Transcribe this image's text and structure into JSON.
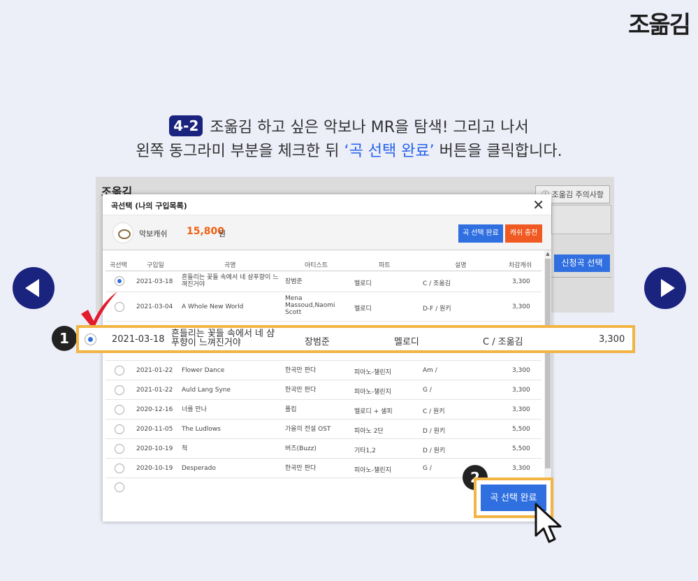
{
  "logo": "조옮김",
  "instruction": {
    "step": "4-2",
    "line1": "조옮김 하고 싶은 악보나 MR을 탐색! 그리고 나서",
    "line2_before": "왼쪽 동그라미 부분을 체크한 뒤 ",
    "line2_highlight": "‘곡 선택 완료’",
    "line2_after": " 버튼을 클릭합니다."
  },
  "background_page": {
    "title": "조옮김",
    "caution_button": "ⓘ 조옮김 주의사항",
    "apply_button": "신청곡 선택"
  },
  "modal": {
    "title": "곡선택 (나의 구입목록)",
    "close": "✕",
    "points_label": "악보캐쉬",
    "points_value": "15,800",
    "points_unit": "원",
    "complete_button": "곡 선택 완료",
    "charge_button": "캐쉬 충전",
    "columns": [
      "곡선택",
      "구입일",
      "곡명",
      "아티스트",
      "파트",
      "설명",
      "차감캐쉬"
    ],
    "rows": [
      {
        "selected": true,
        "date": "2021-03-18",
        "title": "흔들리는 꽃들 속에서 네 샴푸향이 느껴진거야",
        "artist": "장범준",
        "part": "멜로디",
        "desc": "C / 조옮김",
        "price": "3,300"
      },
      {
        "selected": false,
        "date": "2021-03-04",
        "title": "A Whole New World",
        "artist": "Mena Massoud,Naomi Scott",
        "part": "멜로디",
        "desc": "D-F / 원키",
        "price": "3,300"
      },
      {
        "selected": false,
        "date": "",
        "title": "",
        "artist": "",
        "part": "",
        "desc": "",
        "price": ""
      },
      {
        "selected": false,
        "date": "",
        "title": "",
        "artist": "",
        "part": "",
        "desc": "",
        "price": ""
      },
      {
        "selected": false,
        "date": "2021-01-22",
        "title": "Flower Dance",
        "artist": "한곡만 판다",
        "part": "피아노-챌린지",
        "desc": "Am /",
        "price": "3,300"
      },
      {
        "selected": false,
        "date": "2021-01-22",
        "title": "Auld Lang Syne",
        "artist": "한곡만 판다",
        "part": "피아노-챌린지",
        "desc": "G /",
        "price": "3,300"
      },
      {
        "selected": false,
        "date": "2020-12-16",
        "title": "너를 만나",
        "artist": "폴킴",
        "part": "멜로디 + 셀피",
        "desc": "C / 원키",
        "price": "3,300"
      },
      {
        "selected": false,
        "date": "2020-11-05",
        "title": "The Ludlows",
        "artist": "가을의 전설 OST",
        "part": "피아노 2단",
        "desc": "D / 원키",
        "price": "5,500"
      },
      {
        "selected": false,
        "date": "2020-10-19",
        "title": "척",
        "artist": "버즈(Buzz)",
        "part": "기타1,2",
        "desc": "D / 원키",
        "price": "5,500"
      },
      {
        "selected": false,
        "date": "2020-10-19",
        "title": "Desperado",
        "artist": "한곡만 판다",
        "part": "피아노-챌린지",
        "desc": "G /",
        "price": "3,300"
      }
    ]
  },
  "callout_row": {
    "badge": "1",
    "date": "2021-03-18",
    "title": "흔들리는 꽃들 속에서 네 샴푸향이 느껴진거야",
    "artist": "장범준",
    "part": "멜로디",
    "desc": "C / 조옮김",
    "price": "3,300"
  },
  "callout_button": {
    "badge": "2",
    "label": "곡 선택 완료"
  },
  "colors": {
    "accent_blue": "#2f6fe0",
    "navy": "#1a237e",
    "highlight_orange": "#f2b443",
    "cash_orange": "#f06012"
  }
}
